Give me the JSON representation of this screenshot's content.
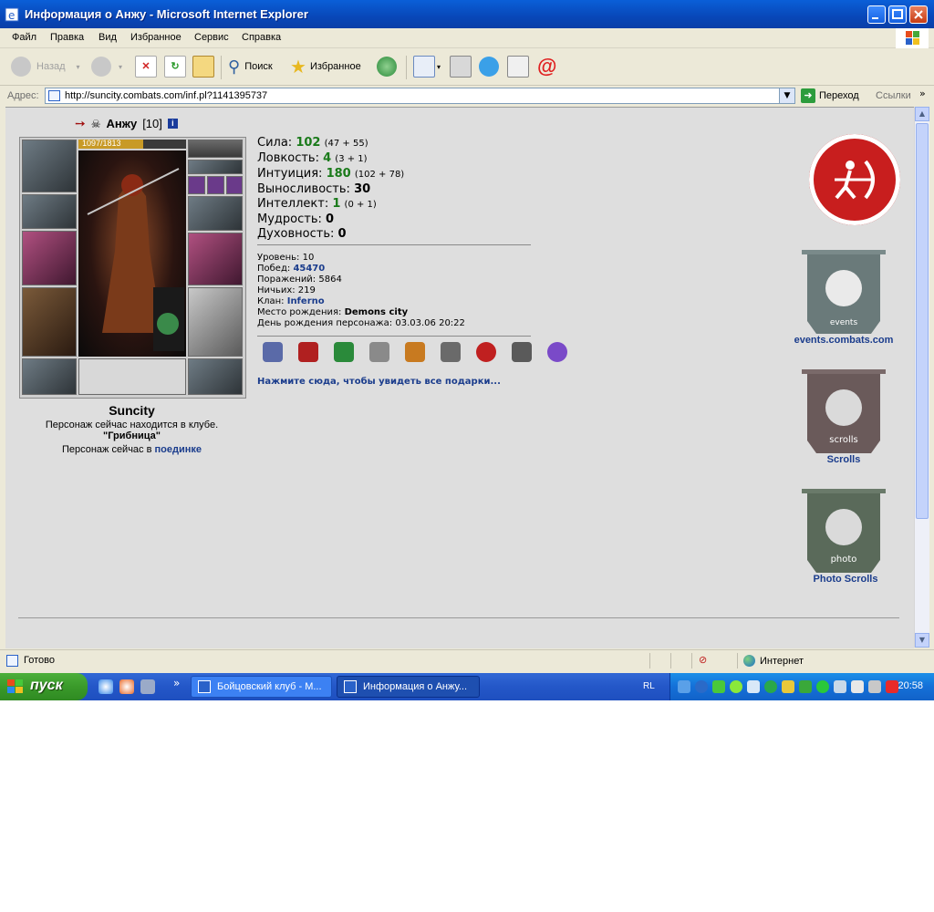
{
  "window": {
    "title": "Информация о Анжу - Microsoft Internet Explorer"
  },
  "menu": [
    "Файл",
    "Правка",
    "Вид",
    "Избранное",
    "Сервис",
    "Справка"
  ],
  "toolbar": {
    "back_label": "Назад",
    "search_label": "Поиск",
    "favorites_label": "Избранное"
  },
  "address": {
    "label": "Адрес:",
    "url": "http://suncity.combats.com/inf.pl?1141395737",
    "go_label": "Переход",
    "links_label": "Ссылки"
  },
  "character": {
    "name": "Анжу",
    "level": "[10]",
    "hp": "1097/1813",
    "hp_fraction": 0.605,
    "city": "Suncity",
    "location_line": "Персонаж сейчас находится в клубе.",
    "location_place": "\"Грибница\"",
    "battle_prefix": "Персонаж сейчас в",
    "battle_link": "поединке"
  },
  "stats": [
    {
      "label": "Сила:",
      "value": "102",
      "detail": "(47 + 55)",
      "boosted": true
    },
    {
      "label": "Ловкость:",
      "value": "4",
      "detail": "(3 + 1)",
      "boosted": true
    },
    {
      "label": "Интуиция:",
      "value": "180",
      "detail": "(102 + 78)",
      "boosted": true
    },
    {
      "label": "Выносливость:",
      "value": "30",
      "detail": "",
      "boosted": false
    },
    {
      "label": "Интеллект:",
      "value": "1",
      "detail": "(0 + 1)",
      "boosted": true
    },
    {
      "label": "Мудрость:",
      "value": "0",
      "detail": "",
      "boosted": false
    },
    {
      "label": "Духовность:",
      "value": "0",
      "detail": "",
      "boosted": false
    }
  ],
  "info": {
    "level_label": "Уровень:",
    "level_value": "10",
    "wins_label": "Побед:",
    "wins_value": "45470",
    "losses_label": "Поражений:",
    "losses_value": "5864",
    "draws_label": "Ничьих:",
    "draws_value": "219",
    "clan_label": "Клан:",
    "clan_value": "Inferno",
    "birthplace_label": "Место рождения:",
    "birthplace_value": "Demons city",
    "birthday_label": "День рождения персонажа:",
    "birthday_value": "03.03.06 20:22"
  },
  "gift_link": "Нажмите сюда, чтобы увидеть все подарки...",
  "banners": {
    "events_img_text": "events",
    "events_label": "events.combats.com",
    "scrolls_img_text": "scrolls",
    "scrolls_label": "Scrolls",
    "photo_img_text": "photo",
    "photo_label": "Photo Scrolls"
  },
  "status": {
    "text": "Готово",
    "zone": "Интернет"
  },
  "taskbar": {
    "start_label": "пуск",
    "task1": "Бойцовский клуб - M...",
    "task2": "Информация о Анжу...",
    "lang": "RL",
    "clock": "20:58"
  },
  "colors": {
    "link": "#1a3c8c",
    "stat_boost": "#1a7a1a",
    "hp_bar": "#c89a26"
  }
}
